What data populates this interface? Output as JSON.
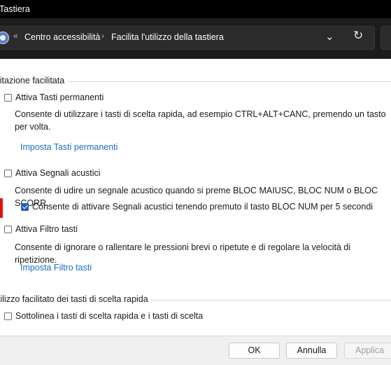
{
  "window": {
    "title": "Tastiera"
  },
  "address": {
    "prefix": "«",
    "crumbs": [
      "Centro accessibilità",
      "Facilita l'utilizzo della tastiera"
    ],
    "separator": "›"
  },
  "sections": [
    {
      "title": "Digitazione facilitata",
      "options": [
        {
          "label": "Attiva Tasti permanenti",
          "checked": false,
          "description": "Consente di utilizzare i tasti di scelta rapida, ad esempio CTRL+ALT+CANC, premendo un tasto per volta.",
          "link": "Imposta Tasti permanenti"
        },
        {
          "label": "Attiva Segnali acustici",
          "checked": false,
          "description": "Consente di udire un segnale acustico quando si preme BLOC MAIUSC, BLOC NUM o BLOC SCORR.",
          "suboption": {
            "label": "Consente di attivare Segnali acustici tenendo premuto il tasto BLOC NUM per 5 secondi",
            "checked": true
          }
        },
        {
          "label": "Attiva Filtro tasti",
          "checked": false,
          "description": "Consente di ignorare o rallentare le pressioni brevi o ripetute e di regolare la velocità di ripetizione.",
          "link": "Imposta Filtro tasti"
        }
      ]
    },
    {
      "title": "Utilizzo facilitato dei tasti di scelta rapida",
      "options": [
        {
          "label": "Sottolinea i tasti di scelta rapida e i tasti di scelta",
          "checked": false
        }
      ]
    }
  ],
  "buttons": {
    "ok": "OK",
    "cancel": "Annulla",
    "apply": "Applica"
  },
  "colors": {
    "link": "#1a6fc9",
    "checkbox_checked": "#1f62b8",
    "titlebar": "#000000"
  }
}
